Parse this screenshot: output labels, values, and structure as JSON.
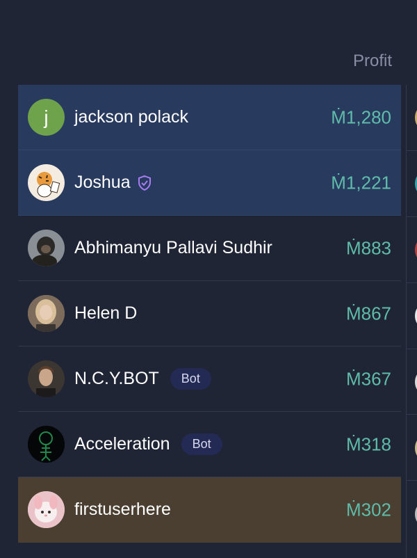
{
  "header": {
    "profit_label": "Profit"
  },
  "rows": [
    {
      "name": "jackson polack",
      "avatar_letter": "j",
      "profit": "Ṁ1,280",
      "highlight": "blue"
    },
    {
      "name": "Joshua",
      "verified": true,
      "profit": "Ṁ1,221",
      "highlight": "blue"
    },
    {
      "name": "Abhimanyu Pallavi Sudhir",
      "profit": "Ṁ883"
    },
    {
      "name": "Helen D",
      "profit": "Ṁ867"
    },
    {
      "name": "N.C.Y.BOT",
      "badge": "Bot",
      "profit": "Ṁ367"
    },
    {
      "name": "Acceleration",
      "badge": "Bot",
      "profit": "Ṁ318"
    },
    {
      "name": "firstuserhere",
      "profit": "Ṁ302",
      "highlight": "brown"
    }
  ],
  "colors": {
    "background": "#1f2535",
    "profit": "#5fbcaa",
    "highlight_blue": "#283a5e",
    "highlight_brown": "#4a3f31",
    "verified": "#a67cf0"
  }
}
